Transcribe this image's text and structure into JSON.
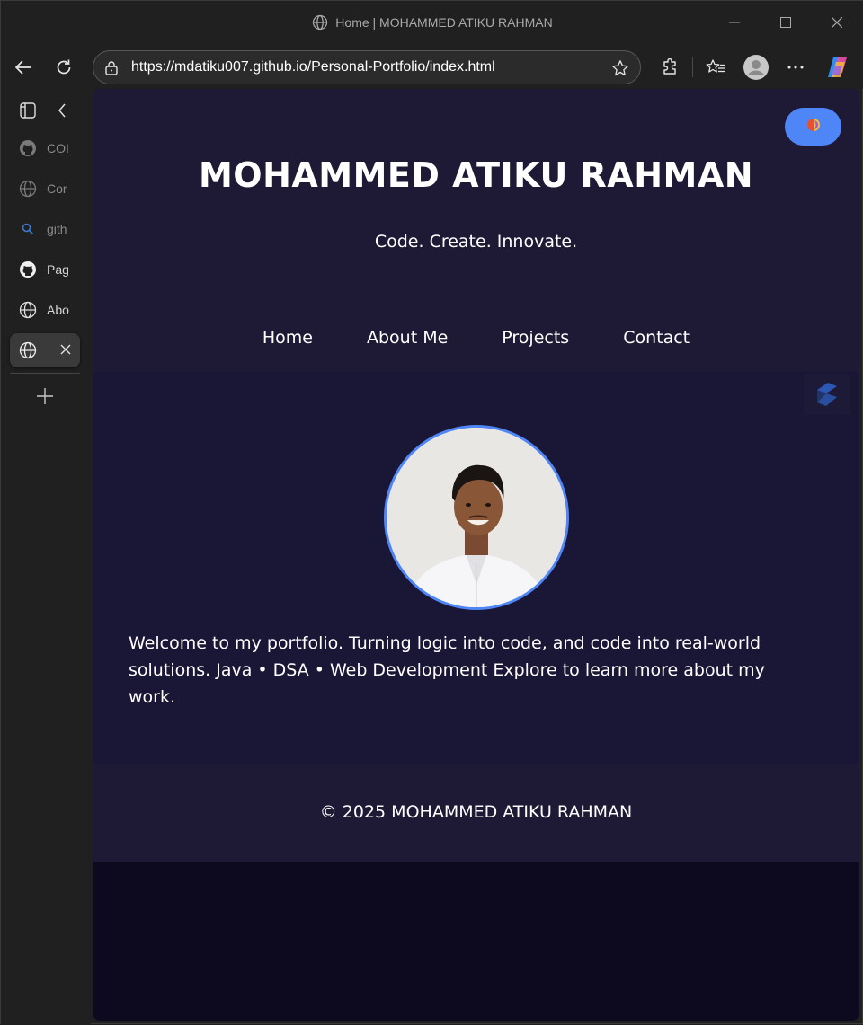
{
  "window": {
    "title": "Home | MOHAMMED ATIKU RAHMAN"
  },
  "toolbar": {
    "url": "https://mdatiku007.github.io/Personal-Portfolio/index.html"
  },
  "sidebar": {
    "tabs": [
      {
        "label": "COI",
        "icon": "github-icon",
        "dim": true
      },
      {
        "label": "Cor",
        "icon": "globe-icon",
        "dim": true
      },
      {
        "label": "gith",
        "icon": "search-icon",
        "dim": true
      },
      {
        "label": "Pag",
        "icon": "github-icon",
        "dim": false
      },
      {
        "label": "Abo",
        "icon": "globe-icon",
        "dim": false
      },
      {
        "label": "",
        "icon": "globe-icon",
        "active": true
      }
    ]
  },
  "site": {
    "title": "MOHAMMED ATIKU RAHMAN",
    "tagline": "Code. Create. Innovate.",
    "nav": [
      "Home",
      "About Me",
      "Projects",
      "Contact"
    ],
    "intro": "Welcome to my portfolio. Turning logic into code, and code into real-world solutions. Java • DSA • Web Development Explore to learn more about my work.",
    "footer": "© 2025 MOHAMMED ATIKU RAHMAN"
  },
  "colors": {
    "accent": "#4f86f7",
    "header_bg": "#1e1a35",
    "hero_bg": "#1a1636",
    "page_bg": "#0d0a1f"
  }
}
